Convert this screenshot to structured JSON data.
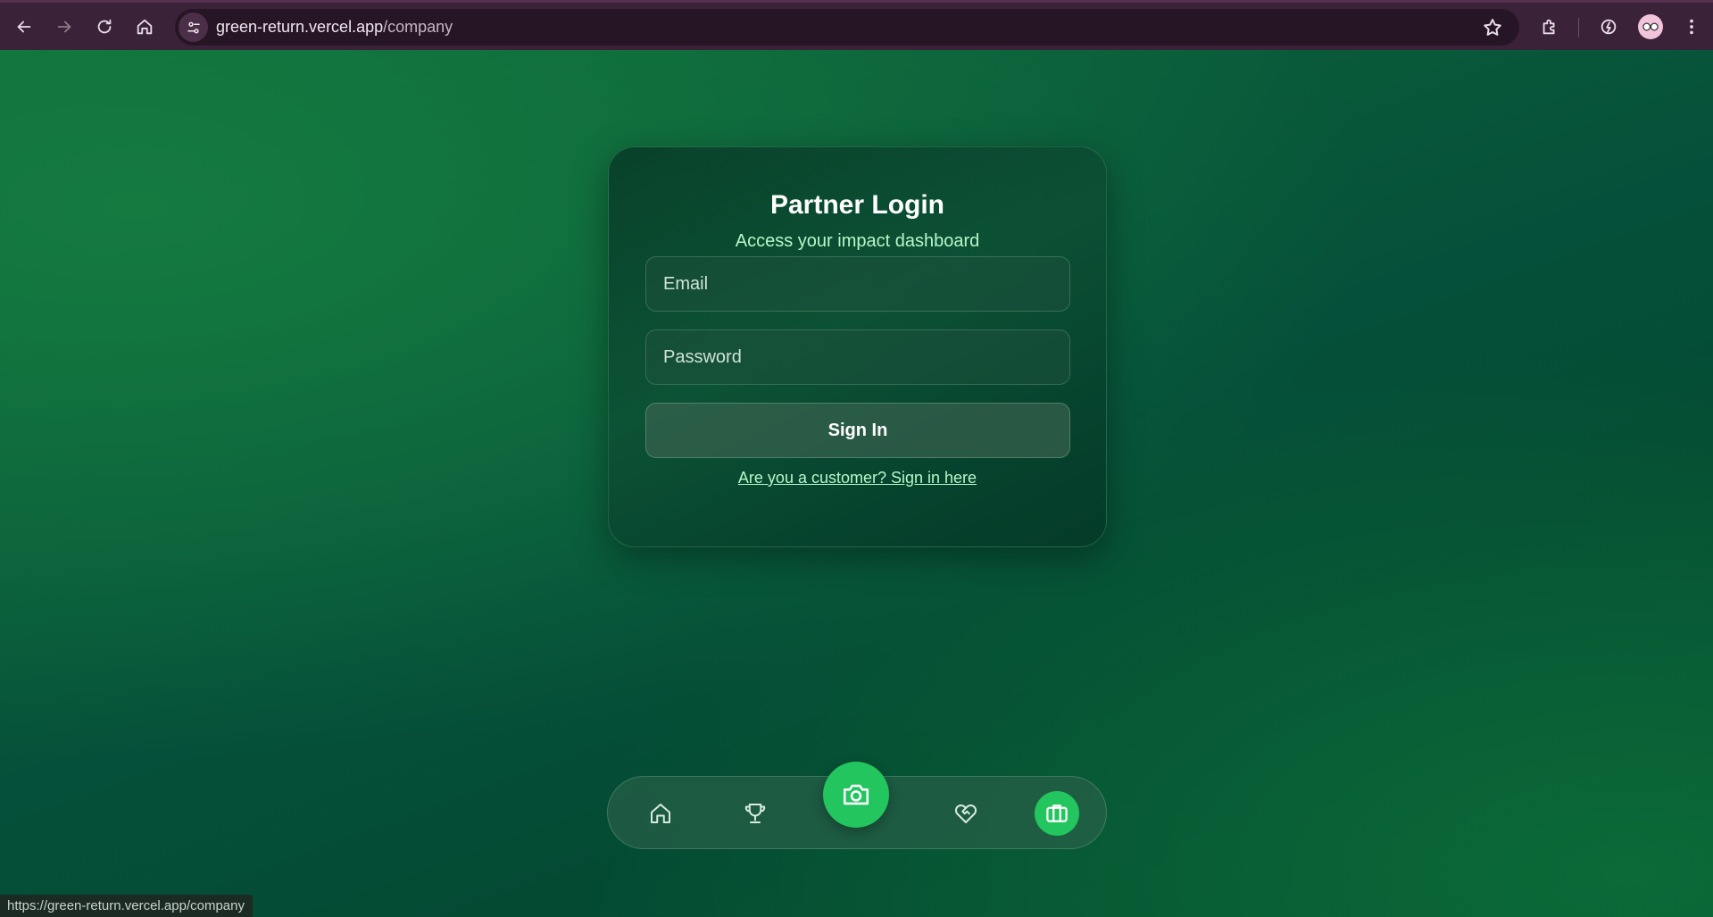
{
  "browser": {
    "url_host": "green-return.vercel.app",
    "url_path": "/company",
    "status_url": "https://green-return.vercel.app/company"
  },
  "login": {
    "title": "Partner Login",
    "subtitle": "Access your impact dashboard",
    "email_placeholder": "Email",
    "password_placeholder": "Password",
    "submit_label": "Sign In",
    "customer_link": "Are you a customer? Sign in here"
  },
  "bottom_nav": {
    "items": [
      {
        "icon": "home-icon"
      },
      {
        "icon": "trophy-icon"
      },
      {
        "icon": "camera-icon"
      },
      {
        "icon": "handshake-heart-icon"
      },
      {
        "icon": "briefcase-icon",
        "active": true
      }
    ]
  },
  "colors": {
    "accent": "#22c55e",
    "subtitle": "#b7f7c8",
    "chrome": "#3a2238"
  }
}
